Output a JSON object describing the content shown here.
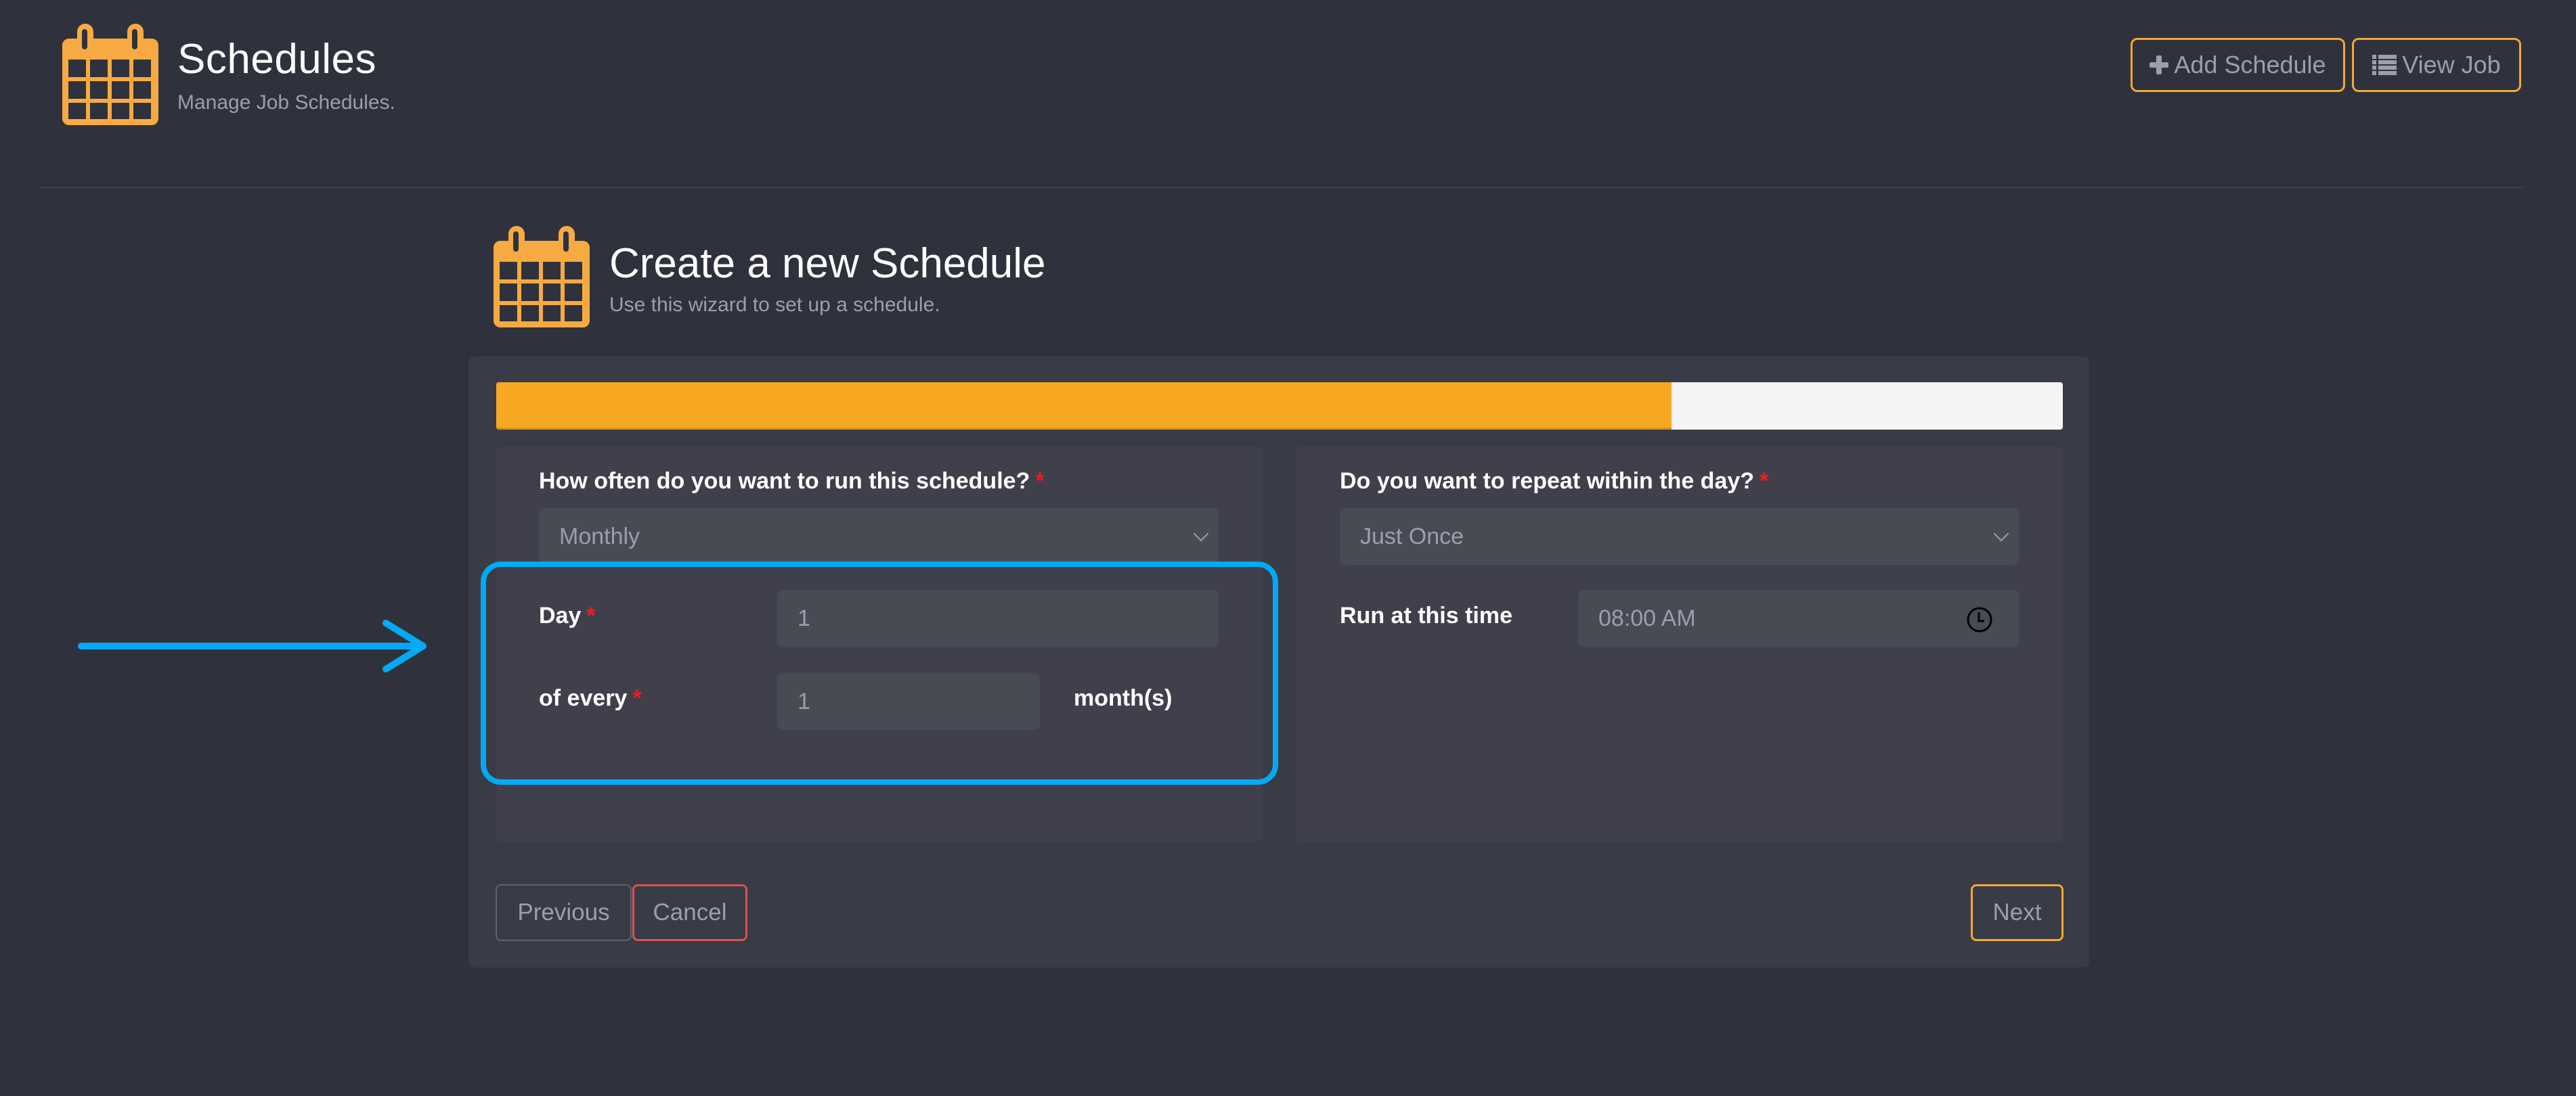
{
  "header": {
    "title": "Schedules",
    "subtitle": "Manage Job Schedules.",
    "icon": "calendar-icon",
    "buttons": {
      "add_schedule": "Add Schedule",
      "view_job": "View Job"
    }
  },
  "wizard": {
    "title": "Create a new Schedule",
    "subtitle": "Use this wizard to set up a schedule.",
    "progress_percent": 75,
    "left_panel": {
      "frequency_label": "How often do you want to run this schedule?",
      "frequency_value": "Monthly",
      "day_label": "Day",
      "day_value": "1",
      "every_label": "of every",
      "every_value": "1",
      "every_unit": "month(s)"
    },
    "right_panel": {
      "repeat_label": "Do you want to repeat within the day?",
      "repeat_value": "Just Once",
      "time_label": "Run at this time",
      "time_value": "08:00 AM"
    },
    "required_mark": "*",
    "buttons": {
      "previous": "Previous",
      "cancel": "Cancel",
      "next": "Next"
    }
  },
  "colors": {
    "accent": "#f6a823",
    "annotation": "#03a9f4",
    "cancel": "#d9534f",
    "required": "#ee1d1d"
  }
}
